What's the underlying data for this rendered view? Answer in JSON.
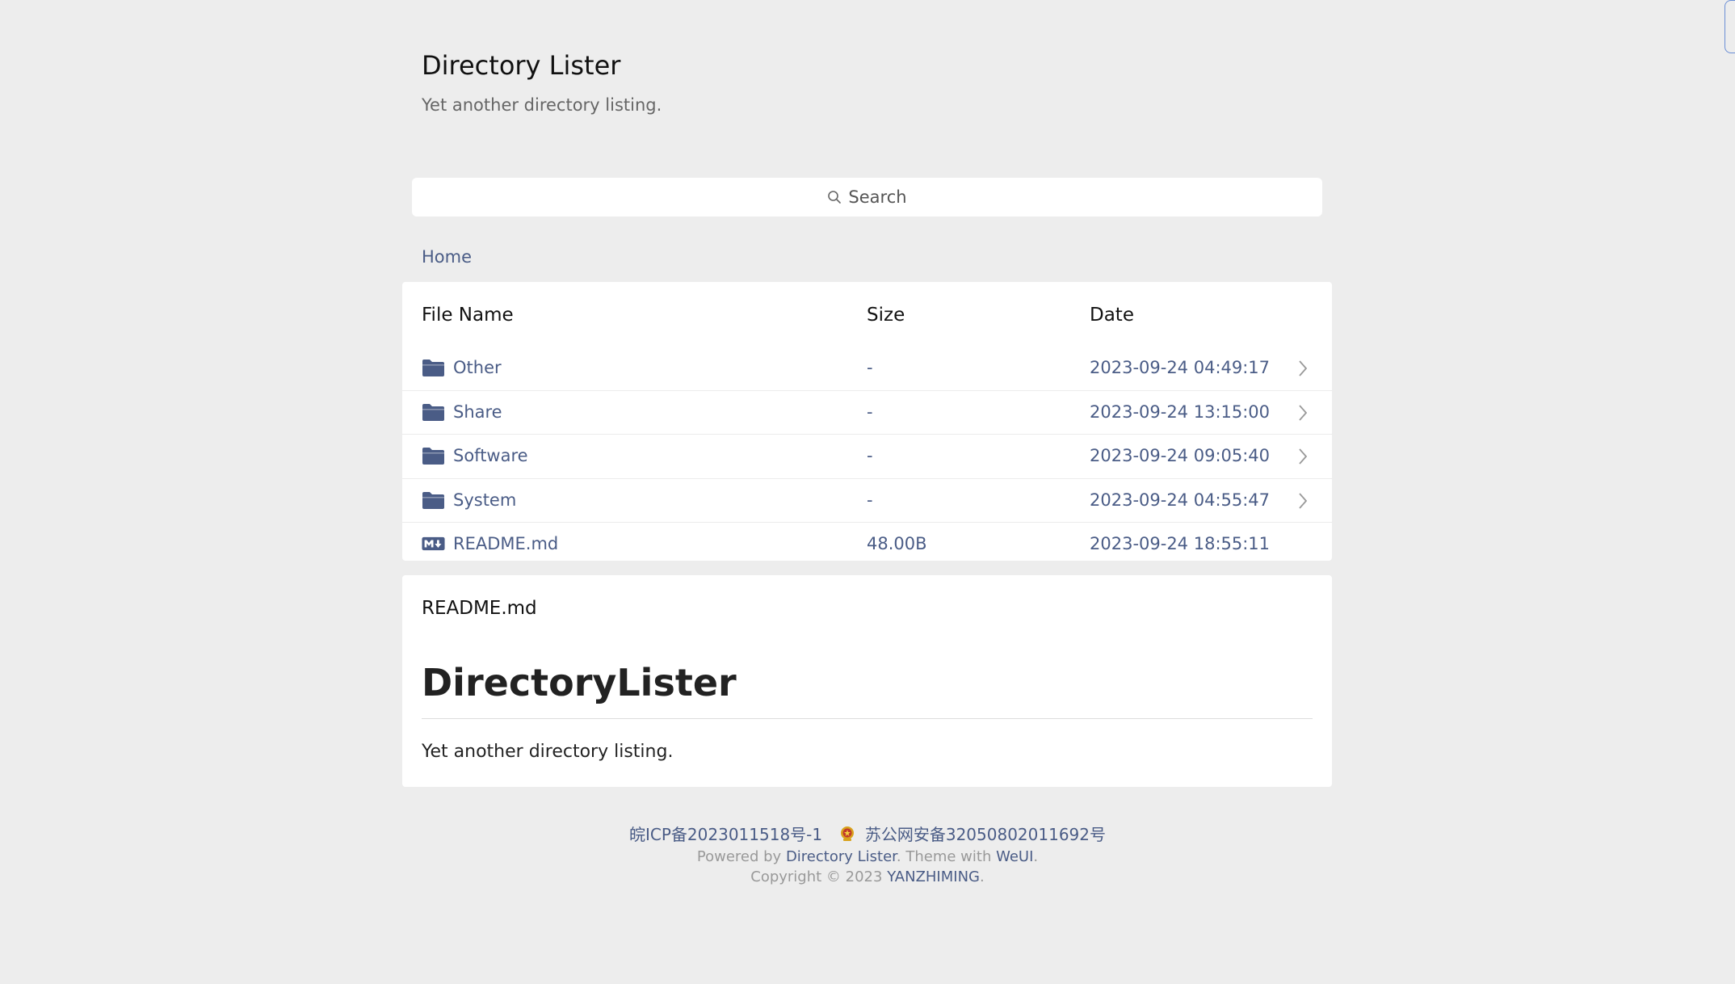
{
  "header": {
    "title": "Directory Lister",
    "subtitle": "Yet another directory listing."
  },
  "search": {
    "placeholder": "Search",
    "icon": "search-icon"
  },
  "breadcrumb": {
    "home": "Home"
  },
  "table": {
    "columns": [
      "File Name",
      "Size",
      "Date"
    ],
    "rows": [
      {
        "icon": "folder-icon",
        "name": "Other",
        "size": "-",
        "date": "2023-09-24 04:49:17",
        "chevron": true
      },
      {
        "icon": "folder-icon",
        "name": "Share",
        "size": "-",
        "date": "2023-09-24 13:15:00",
        "chevron": true
      },
      {
        "icon": "folder-icon",
        "name": "Software",
        "size": "-",
        "date": "2023-09-24 09:05:40",
        "chevron": true
      },
      {
        "icon": "folder-icon",
        "name": "System",
        "size": "-",
        "date": "2023-09-24 04:55:47",
        "chevron": true
      },
      {
        "icon": "markdown-icon",
        "name": "README.md",
        "size": "48.00B",
        "date": "2023-09-24 18:55:11",
        "chevron": false
      }
    ]
  },
  "readme": {
    "filename": "README.md",
    "heading": "DirectoryLister",
    "paragraph": "Yet another directory listing."
  },
  "footer": {
    "icp": "皖ICP备2023011518号-1",
    "police": "苏公网安备32050802011692号",
    "powered_prefix": "Powered by ",
    "powered_link": "Directory Lister",
    "theme_prefix": ". Theme with ",
    "theme_link": "WeUI",
    "theme_suffix": ".",
    "copyright_prefix": "Copyright © 2023 ",
    "copyright_link": "YANZHIMING",
    "copyright_suffix": "."
  },
  "colors": {
    "background": "#ededed",
    "card": "#ffffff",
    "link": "#4a5c86",
    "muted": "#999999"
  }
}
